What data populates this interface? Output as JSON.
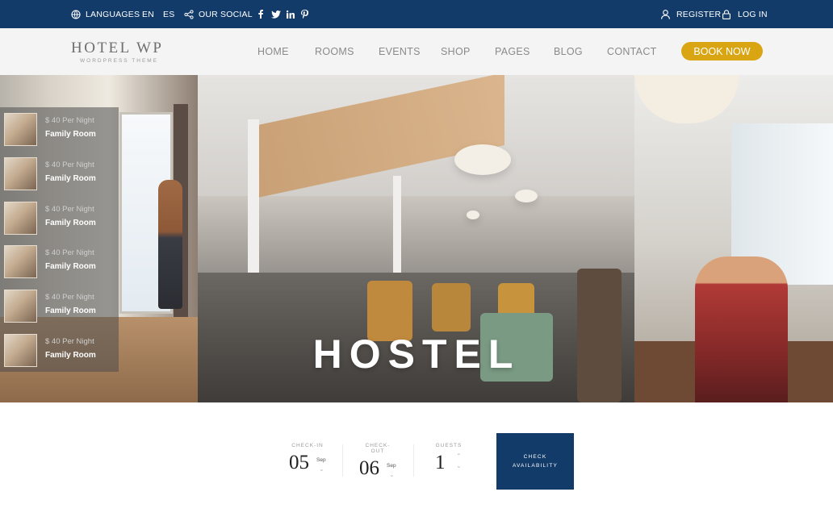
{
  "topbar": {
    "languages_label": "LANGUAGES",
    "lang_en": "EN",
    "lang_es": "ES",
    "social_label": "OUR SOCIAL",
    "social_icons": [
      "facebook-icon",
      "twitter-icon",
      "linkedin-icon",
      "pinterest-icon"
    ],
    "register_label": "REGISTER",
    "login_label": "LOG IN"
  },
  "header": {
    "logo_title": "HOTEL WP",
    "logo_subtitle": "WORDPRESS THEME",
    "nav": [
      "HOME",
      "ROOMS",
      "EVENTS",
      "SHOP",
      "PAGES",
      "BLOG",
      "CONTACT"
    ],
    "book_now": "BOOK NOW"
  },
  "hero": {
    "title": "HOSTEL",
    "rooms": [
      {
        "price": "$ 40 Per Night",
        "name": "Family Room"
      },
      {
        "price": "$ 40 Per Night",
        "name": "Family Room"
      },
      {
        "price": "$ 40 Per Night",
        "name": "Family Room"
      },
      {
        "price": "$ 40 Per Night",
        "name": "Family Room"
      },
      {
        "price": "$ 40 Per Night",
        "name": "Family Room"
      },
      {
        "price": "$ 40 Per Night",
        "name": "Family Room"
      }
    ]
  },
  "booking": {
    "checkin_label": "CHECK-IN",
    "checkin_day": "05",
    "checkin_month": "Sep",
    "checkout_label": "CHECK-OUT",
    "checkout_day": "06",
    "checkout_month": "Sep",
    "guests_label": "GUESTS",
    "guests_value": "1",
    "check_line1": "CHECK",
    "check_line2": "AVAILABILITY"
  },
  "colors": {
    "topbar": "#133b6a",
    "accent": "#d9a512",
    "button": "#133b6a"
  }
}
